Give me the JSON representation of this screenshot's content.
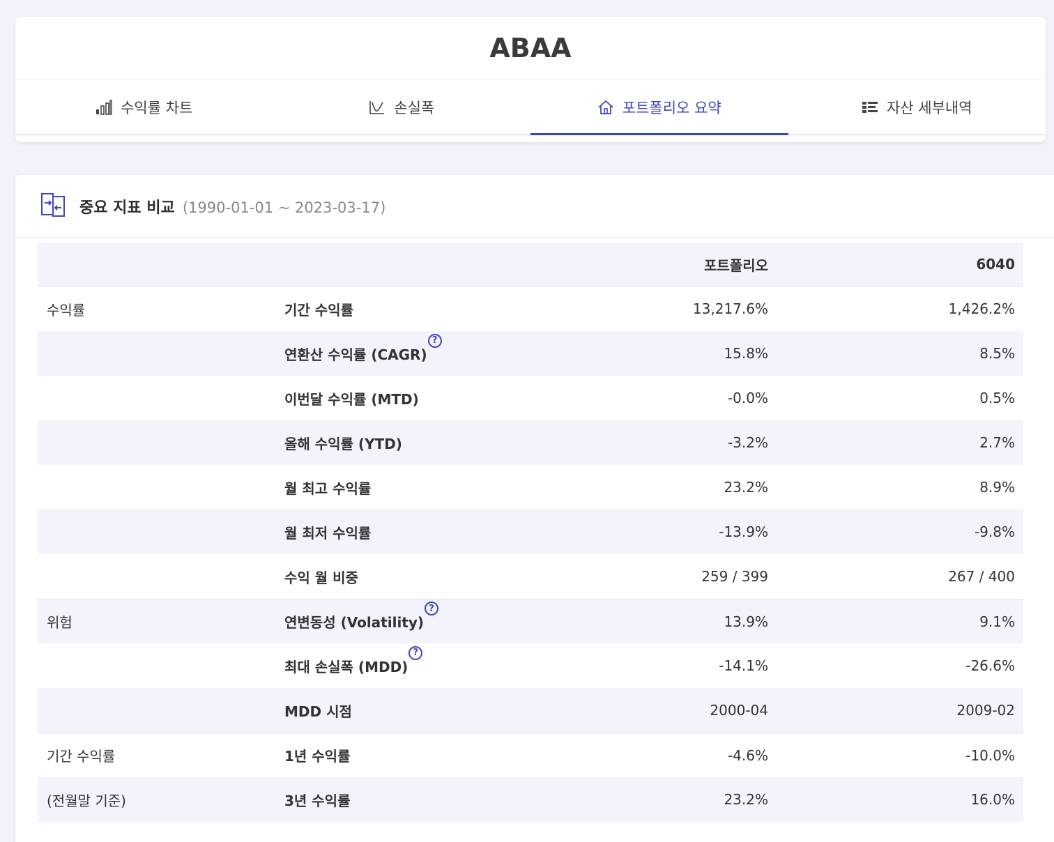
{
  "title": "ABAA",
  "tabs": [
    {
      "label": "수익률 차트",
      "icon": "bar-chart-icon",
      "active": false
    },
    {
      "label": "손실폭",
      "icon": "drawdown-chart-icon",
      "active": false
    },
    {
      "label": "포트폴리오 요약",
      "icon": "home-icon",
      "active": true
    },
    {
      "label": "자산 세부내역",
      "icon": "list-icon",
      "active": false
    }
  ],
  "section": {
    "title": "중요 지표 비교",
    "range": "(1990-01-01 ~ 2023-03-17)",
    "icon": "compare-icon"
  },
  "table": {
    "headers": [
      "",
      "",
      "포트폴리오",
      "6040"
    ],
    "rows": [
      {
        "group": "수익률",
        "metric": "기간 수익률",
        "portfolio": "13,217.6%",
        "benchmark": "1,426.2%",
        "help": false
      },
      {
        "group": "",
        "metric": "연환산 수익률 (CAGR)",
        "portfolio": "15.8%",
        "benchmark": "8.5%",
        "help": true
      },
      {
        "group": "",
        "metric": "이번달 수익률 (MTD)",
        "portfolio": "-0.0%",
        "benchmark": "0.5%",
        "help": false
      },
      {
        "group": "",
        "metric": "올해 수익률 (YTD)",
        "portfolio": "-3.2%",
        "benchmark": "2.7%",
        "help": false
      },
      {
        "group": "",
        "metric": "월 최고 수익률",
        "portfolio": "23.2%",
        "benchmark": "8.9%",
        "help": false
      },
      {
        "group": "",
        "metric": "월 최저 수익률",
        "portfolio": "-13.9%",
        "benchmark": "-9.8%",
        "help": false
      },
      {
        "group": "",
        "metric": "수익 월 비중",
        "portfolio": "259 / 399",
        "benchmark": "267 / 400",
        "help": false
      },
      {
        "group": "위험",
        "metric": "연변동성 (Volatility)",
        "portfolio": "13.9%",
        "benchmark": "9.1%",
        "help": true
      },
      {
        "group": "",
        "metric": "최대 손실폭 (MDD)",
        "portfolio": "-14.1%",
        "benchmark": "-26.6%",
        "help": true
      },
      {
        "group": "",
        "metric": "MDD 시점",
        "portfolio": "2000-04",
        "benchmark": "2009-02",
        "help": false
      },
      {
        "group": "기간 수익률",
        "metric": "1년 수익률",
        "portfolio": "-4.6%",
        "benchmark": "-10.0%",
        "help": false
      },
      {
        "group": "(전월말 기준)",
        "metric": "3년 수익률",
        "portfolio": "23.2%",
        "benchmark": "16.0%",
        "help": false
      }
    ],
    "help_glyph": "?"
  },
  "colors": {
    "accent": "#3d46c2",
    "background": "#f2f3fa",
    "row_alt": "#f2f3fb"
  }
}
